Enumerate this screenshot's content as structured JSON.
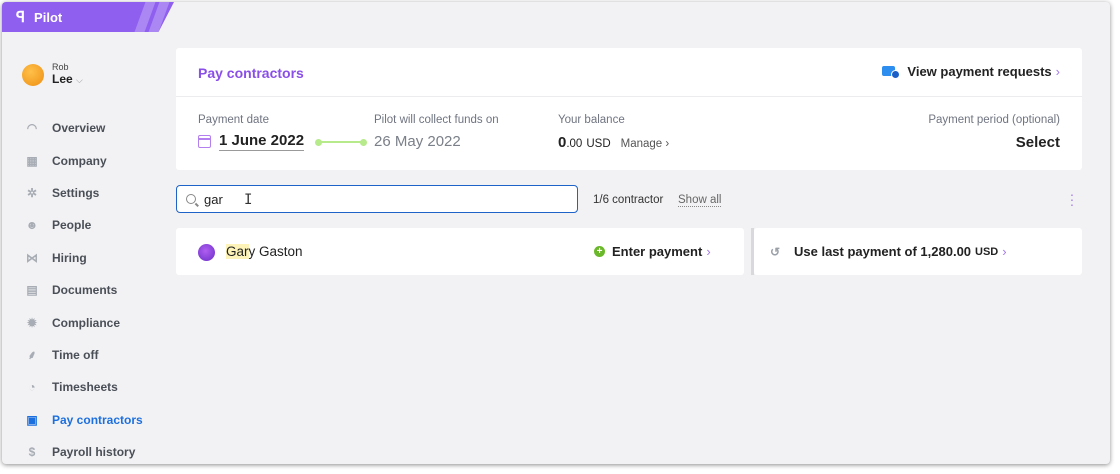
{
  "brand": {
    "name": "Pilot",
    "accent": "#8f5ff0"
  },
  "user": {
    "first": "Rob",
    "last": "Lee"
  },
  "sidebar": {
    "items": [
      {
        "label": "Overview",
        "icon": "gauge-icon",
        "active": false
      },
      {
        "label": "Company",
        "icon": "building-icon",
        "active": false
      },
      {
        "label": "Settings",
        "icon": "gear-icon",
        "active": false
      },
      {
        "label": "People",
        "icon": "smiley-icon",
        "active": false
      },
      {
        "label": "Hiring",
        "icon": "handshake-icon",
        "active": false
      },
      {
        "label": "Documents",
        "icon": "document-icon",
        "active": false
      },
      {
        "label": "Compliance",
        "icon": "badge-icon",
        "active": false
      },
      {
        "label": "Time off",
        "icon": "palm-tree-icon",
        "active": false
      },
      {
        "label": "Timesheets",
        "icon": "clock-icon",
        "active": false
      },
      {
        "label": "Pay contractors",
        "icon": "money-icon",
        "active": true
      },
      {
        "label": "Payroll history",
        "icon": "dollar-circle-icon",
        "active": false
      }
    ]
  },
  "header": {
    "title": "Pay contractors",
    "view_requests": "View payment requests",
    "payment_date_label": "Payment date",
    "payment_date": "1 June 2022",
    "collect_label": "Pilot will collect funds on",
    "collect_date": "26 May 2022",
    "balance_label": "Your balance",
    "balance_int": "0",
    "balance_dec": ".00",
    "balance_unit": "USD",
    "manage": "Manage",
    "period_label": "Payment period (optional)",
    "period_value": "Select"
  },
  "search": {
    "value": "gar",
    "count": "1/6 contractor",
    "show_all": "Show all"
  },
  "result": {
    "name_match": "Gar",
    "name_rest": "y Gaston",
    "enter_payment": "Enter payment",
    "use_last": "Use last payment of 1,280.00",
    "use_last_unit": "USD"
  }
}
